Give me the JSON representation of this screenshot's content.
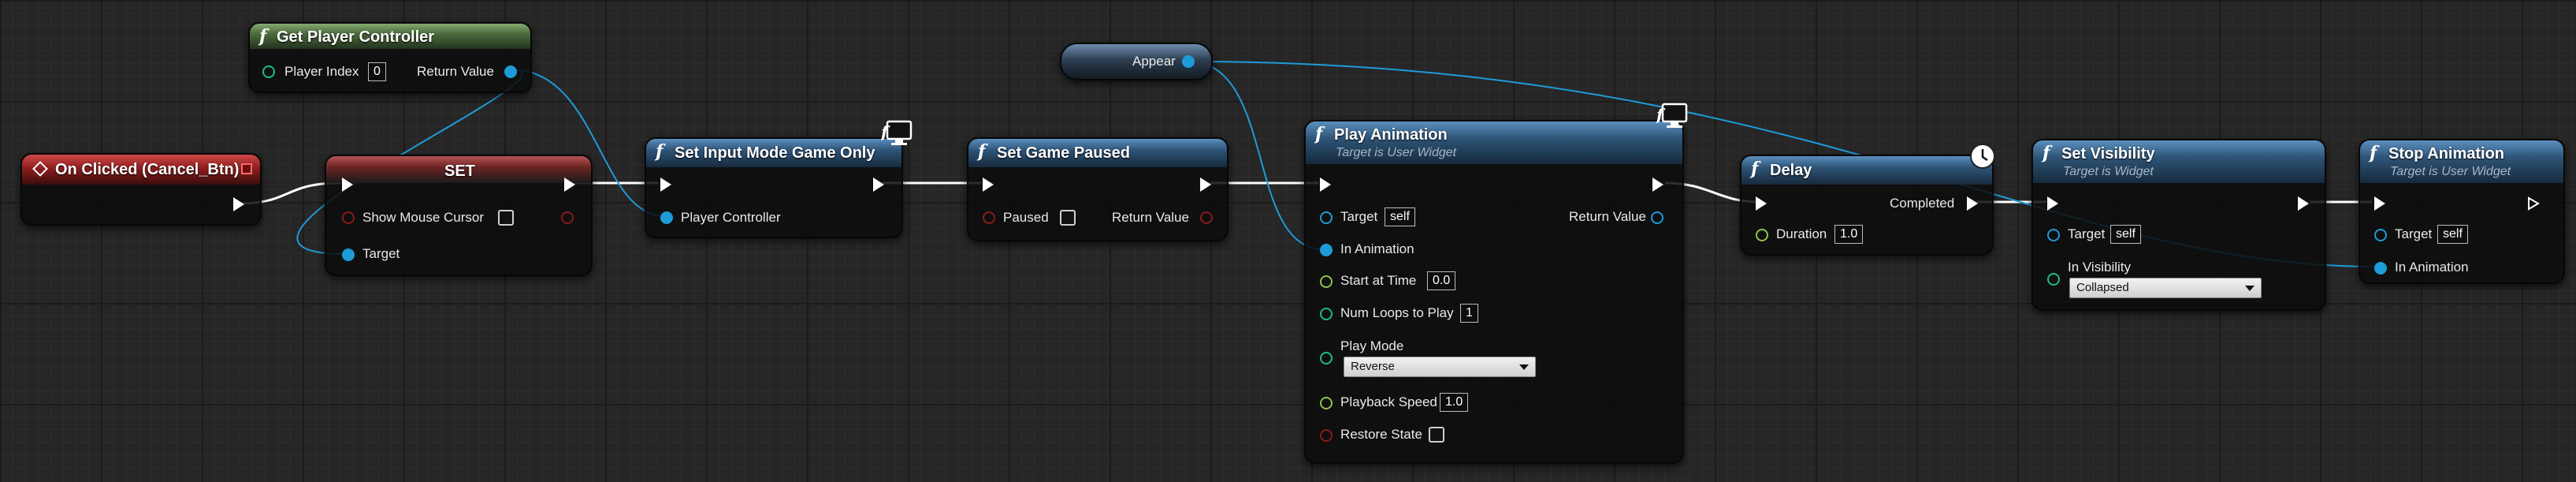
{
  "nodes": {
    "get_player_controller": {
      "title": "Get Player Controller",
      "player_index_label": "Player Index",
      "player_index_value": "0",
      "return_value_label": "Return Value"
    },
    "on_clicked": {
      "title": "On Clicked (Cancel_Btn)"
    },
    "set_node": {
      "title": "SET",
      "show_mouse_cursor_label": "Show Mouse Cursor",
      "target_label": "Target"
    },
    "set_input_mode": {
      "title": "Set Input Mode Game Only",
      "player_controller_label": "Player Controller"
    },
    "set_game_paused": {
      "title": "Set Game Paused",
      "paused_label": "Paused",
      "return_value_label": "Return Value"
    },
    "appear": {
      "title": "Appear"
    },
    "play_animation": {
      "title": "Play Animation",
      "subtitle": "Target is User Widget",
      "target_label": "Target",
      "target_value": "self",
      "return_value_label": "Return Value",
      "in_animation_label": "In Animation",
      "start_at_time_label": "Start at Time",
      "start_at_time_value": "0.0",
      "num_loops_label": "Num Loops to Play",
      "num_loops_value": "1",
      "play_mode_label": "Play Mode",
      "play_mode_value": "Reverse",
      "playback_speed_label": "Playback Speed",
      "playback_speed_value": "1.0",
      "restore_state_label": "Restore State"
    },
    "delay": {
      "title": "Delay",
      "completed_label": "Completed",
      "duration_label": "Duration",
      "duration_value": "1.0"
    },
    "set_visibility": {
      "title": "Set Visibility",
      "subtitle": "Target is Widget",
      "target_label": "Target",
      "target_value": "self",
      "in_visibility_label": "In Visibility",
      "in_visibility_value": "Collapsed"
    },
    "stop_animation": {
      "title": "Stop Animation",
      "subtitle": "Target is User Widget",
      "target_label": "Target",
      "target_value": "self",
      "in_animation_label": "In Animation"
    }
  },
  "icons": {
    "function": "function-icon",
    "event": "event-diamond-icon",
    "delegate": "delegate-square-icon",
    "latent": "clock-icon",
    "widget": "widget-monitor-icon"
  },
  "colors": {
    "exec_wire": "#ffffff",
    "object_wire": "#1e9bd8",
    "bool_pin": "#8a1a1a",
    "float_pin": "#8fc34a",
    "int_pin": "#1fb98f",
    "function_header": "#2e5477",
    "pure_header": "#4b6b3c",
    "event_header": "#8f1e1e"
  }
}
